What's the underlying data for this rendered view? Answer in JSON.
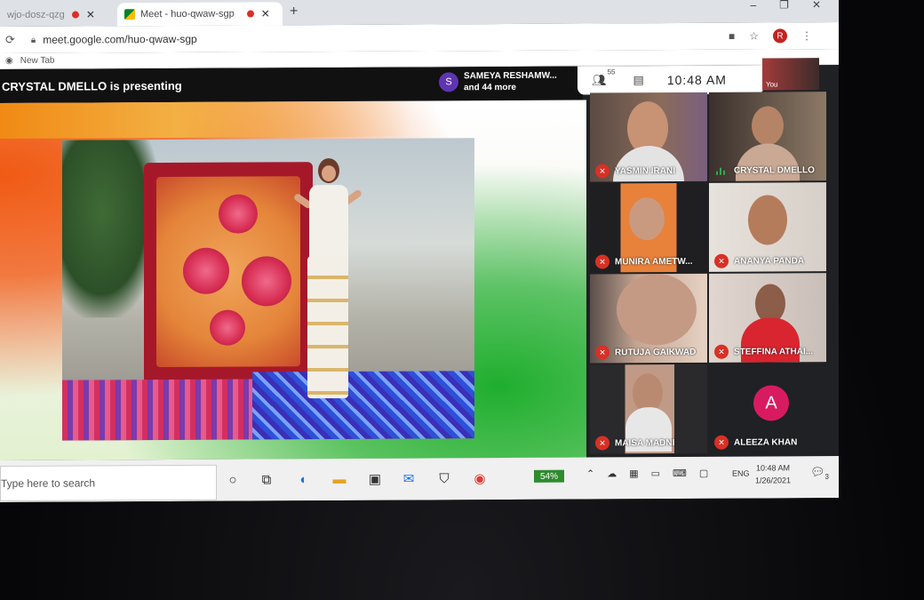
{
  "browser": {
    "tabs": [
      {
        "label": "wjo-dosz-qzg",
        "active": false,
        "recording": true
      },
      {
        "label": "Meet - huo-qwaw-sgp",
        "active": true,
        "recording": true
      }
    ],
    "new_tab_icon": "+",
    "url": "meet.google.com/huo-qwaw-sgp",
    "profile_initial": "R",
    "bookmark": "New Tab"
  },
  "meet": {
    "presenting_text": "CRYSTAL DMELLO is presenting",
    "chip_avatar": "S",
    "chip_line1": "SAMEYA RESHAMW...",
    "chip_line2": "and 44 more",
    "people_count": "55",
    "time": "10:48 AM",
    "you_label": "You",
    "participants": [
      {
        "name": "YASMIN IRANI",
        "muted": true
      },
      {
        "name": "CRYSTAL DMELLO",
        "muted": false
      },
      {
        "name": "MUNIRA AMETW...",
        "muted": true
      },
      {
        "name": "ANANYA PANDA",
        "muted": true
      },
      {
        "name": "RUTUJA GAIKWAD",
        "muted": true
      },
      {
        "name": "STEFFINA ATHAI...",
        "muted": true
      },
      {
        "name": "MAISA MADNI",
        "muted": true
      },
      {
        "name": "ALEEZA KHAN",
        "muted": true,
        "avatar": "A"
      }
    ]
  },
  "taskbar": {
    "search_placeholder": "Type here to search",
    "battery": "54%",
    "language": "ENG",
    "time": "10:48 AM",
    "date": "1/26/2021",
    "notification_count": "3"
  },
  "colors": {
    "mute_red": "#d93025",
    "avatar_pink": "#d81b60",
    "chip_purple": "#5e35b1",
    "battery_green": "#2e8b2e"
  }
}
